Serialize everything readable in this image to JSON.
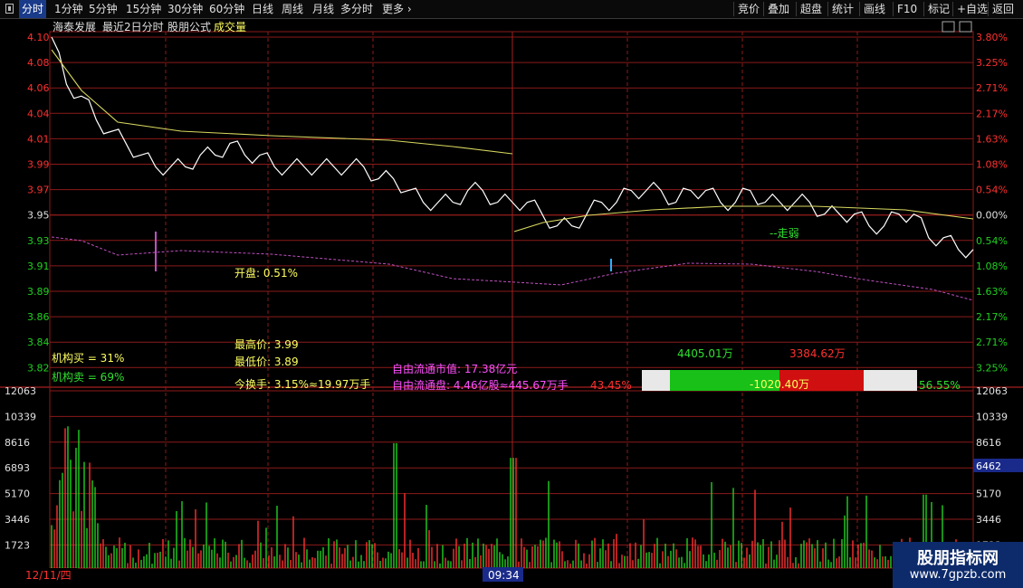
{
  "toolbar": {
    "left_tabs": [
      "分时",
      "1分钟",
      "5分钟",
      "15分钟",
      "30分钟",
      "60分钟",
      "日线",
      "周线",
      "月线",
      "多分时",
      "更多"
    ],
    "active_tab": "分时",
    "right_buttons": [
      "竞价",
      "叠加",
      "超盘",
      "统计",
      "画线",
      "F10",
      "标记",
      "+自选",
      "返回"
    ]
  },
  "header": {
    "stock_name": "海泰发展",
    "mode": "最近2日分时",
    "formula": "股朋公式",
    "indicator": "成交量"
  },
  "price_axis": {
    "left_labels": [
      "4.10",
      "4.08",
      "4.06",
      "4.04",
      "4.01",
      "3.99",
      "3.97",
      "3.95",
      "3.93",
      "3.91",
      "3.89",
      "3.86",
      "3.84",
      "3.82"
    ],
    "right_labels": [
      "3.80%",
      "3.25%",
      "2.71%",
      "2.17%",
      "1.63%",
      "1.08%",
      "0.54%",
      "0.00%",
      "0.54%",
      "1.08%",
      "1.63%",
      "2.17%",
      "2.71%",
      "3.25%"
    ],
    "prev_close": 3.95
  },
  "volume_axis": {
    "left_labels": [
      "12063",
      "10339",
      "8616",
      "6893",
      "5170",
      "3446",
      "1723"
    ],
    "right_labels": [
      "12063",
      "10339",
      "8616",
      "6893",
      "5170",
      "3446",
      "1723"
    ],
    "current_volume_tag": "6462"
  },
  "annotations": {
    "open_label": "开盘:",
    "open_value": "0.51%",
    "high_label": "最高价:",
    "high_value": "3.99",
    "low_label": "最低价:",
    "low_value": "3.89",
    "turnover_label": "今换手:",
    "turnover_value": "3.15%≈19.97万手",
    "inst_buy": "机构买 = 31%",
    "inst_sell": "机构卖 = 69%",
    "free_mcap": "自由流通市值: 17.38亿元",
    "free_float": "自由流通盘: 4.46亿股≈445.67万手",
    "trend_label": "--走弱",
    "buy_amount": "4405.01万",
    "sell_amount": "3384.62万",
    "net_amount": "-1020.40万",
    "sell_pct": "43.45%",
    "buy_pct": "56.55%"
  },
  "footer": {
    "date_label": "12/11/四",
    "cursor_time": "09:34"
  },
  "watermark": {
    "title": "股朋指标网",
    "url": "www.7gpzb.com"
  },
  "colors": {
    "grid": "#8b1a1a",
    "price_line": "#ffffff",
    "avg_line": "#d8d860",
    "ma_line": "#c050c0",
    "up": "#ff3030",
    "down": "#20d020",
    "text_yellow": "#ffff60",
    "text_magenta": "#ff50ff",
    "text_green": "#30e030",
    "text_red": "#ff3030"
  },
  "chart_data": {
    "type": "line",
    "day_boundary_index": 120,
    "price_series_sample": [
      4.1,
      4.06,
      4.05,
      4.03,
      4.02,
      4.01,
      4.0,
      3.99,
      3.99,
      3.99,
      4.0,
      4.0,
      4.01,
      4.0,
      4.0,
      3.99,
      3.99,
      3.99,
      3.99,
      3.99,
      3.99,
      3.99,
      3.98,
      3.98,
      3.97,
      3.96,
      3.96,
      3.96,
      3.97,
      3.97,
      3.96,
      3.96,
      3.96,
      3.95,
      3.94,
      3.94,
      3.95,
      3.96,
      3.96,
      3.97,
      3.97,
      3.97,
      3.96,
      3.97,
      3.97,
      3.96,
      3.96,
      3.97,
      3.96,
      3.96,
      3.96,
      3.96,
      3.95,
      3.95,
      3.95,
      3.94,
      3.94,
      3.95,
      3.95,
      3.93,
      3.93,
      3.92,
      3.92
    ],
    "volume_max": 12063
  }
}
